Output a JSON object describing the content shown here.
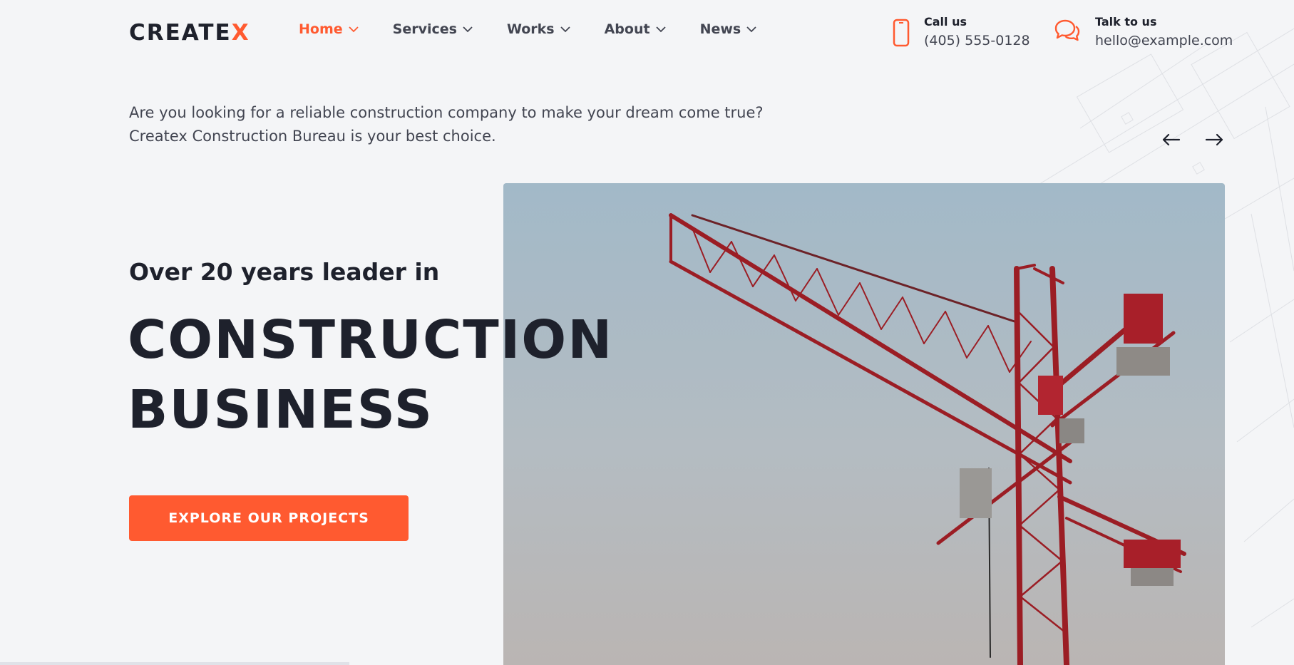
{
  "brand": {
    "logo_main": "CREATE",
    "logo_accent": "X",
    "accent_color": "#ff5a30"
  },
  "nav": {
    "items": [
      {
        "label": "Home",
        "active": true
      },
      {
        "label": "Services"
      },
      {
        "label": "Works"
      },
      {
        "label": "About"
      },
      {
        "label": "News"
      }
    ]
  },
  "contacts": {
    "phone": {
      "title": "Call us",
      "value": "(405) 555-0128",
      "icon": "phone-icon"
    },
    "email": {
      "title": "Talk to us",
      "value": "hello@example.com",
      "icon": "chat-icon"
    }
  },
  "intro": {
    "line1": "Are you looking for a reliable construction company to make your dream come true?",
    "line2": "Createx Construction Bureau is your best choice."
  },
  "slider": {
    "prev_icon": "arrow-left-icon",
    "next_icon": "arrow-right-icon"
  },
  "hero": {
    "subtitle": "Over 20 years leader in",
    "title_line1": "CONSTRUCTION",
    "title_line2": "BUSINESS",
    "cta_label": "EXPLORE OUR PROJECTS",
    "image": "crane-photo"
  }
}
